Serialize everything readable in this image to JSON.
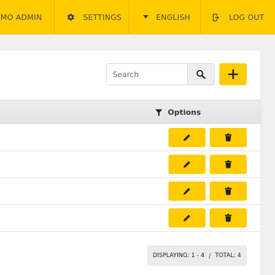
{
  "nav": {
    "admin_label": "DEMO ADMIN",
    "settings_label": "SETTINGS",
    "language_label": "ENGLISH",
    "logout_label": "LOG OUT",
    "icons": [
      "user-icon",
      "gear-icon",
      "caret-down-icon",
      "logout-icon"
    ]
  },
  "toolbar": {
    "search_placeholder": "Search",
    "search_value": "",
    "search_icon": "search-icon",
    "add_label": "+"
  },
  "table": {
    "options_header": "Options",
    "filter_icon": "filter-icon",
    "rows": [
      {
        "edit_icon": "pencil-icon",
        "delete_icon": "trash-icon"
      },
      {
        "edit_icon": "pencil-icon",
        "delete_icon": "trash-icon"
      },
      {
        "edit_icon": "pencil-icon",
        "delete_icon": "trash-icon"
      },
      {
        "edit_icon": "pencil-icon",
        "delete_icon": "trash-icon"
      }
    ]
  },
  "pager": {
    "displaying": "DISPLAYING: 1 - 4",
    "separator": "/",
    "total": "TOTAL: 4"
  },
  "colors": {
    "accent": "#ffcc00",
    "background": "#f0f0f0",
    "panel": "#ffffff",
    "text": "#4a4a4a"
  }
}
